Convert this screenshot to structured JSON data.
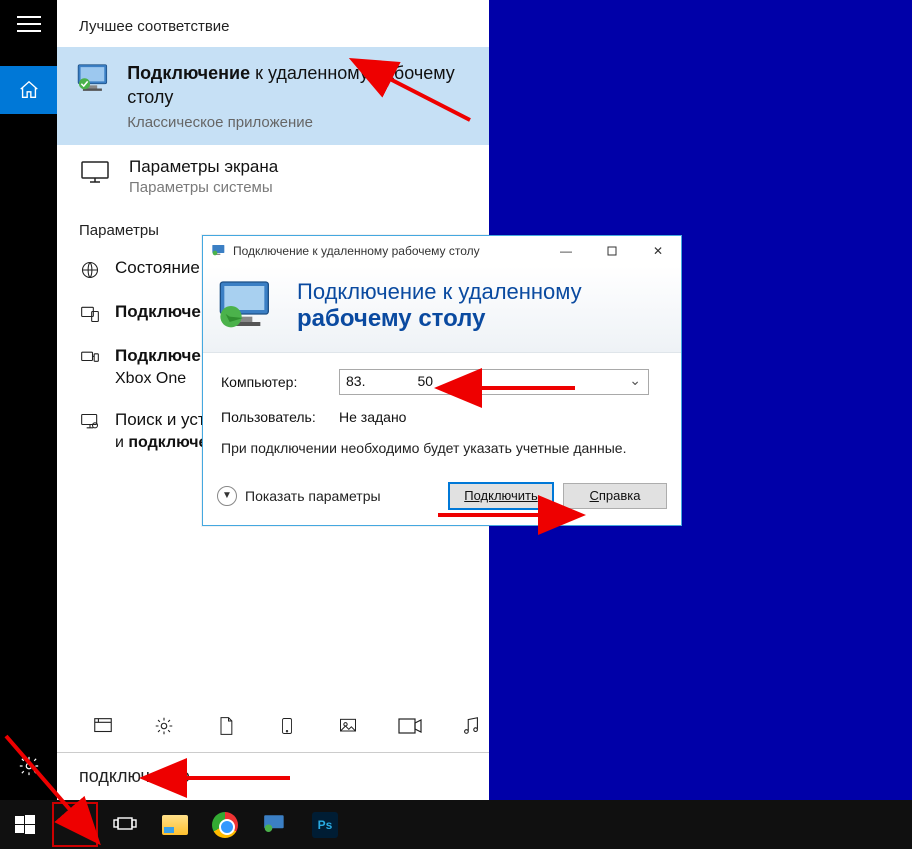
{
  "rail": {
    "home": "home",
    "hamburger": "menu",
    "settings": "settings"
  },
  "panel": {
    "best_match_header": "Лучшее соответствие",
    "best_match": {
      "title_prefix": "Подключение",
      "title_rest": " к удаленному рабочему столу",
      "subtitle": "Классическое приложение"
    },
    "second_result": {
      "title": "Параметры экрана",
      "subtitle": "Параметры системы"
    },
    "params_header": "Параметры",
    "params": [
      {
        "icon": "globe",
        "label": "Состояние сети"
      },
      {
        "icon": "devices",
        "label_prefix": "Подключение",
        "label_rest": ""
      },
      {
        "icon": "stream",
        "label_prefix": "Подключение",
        "label_rest": "",
        "sub": "Xbox One"
      },
      {
        "icon": "monitor-tool",
        "label": "Поиск и устранение",
        "sub_prefix": "и ",
        "sub_bold": "подключение"
      }
    ],
    "categories": [
      "apps",
      "settings",
      "document",
      "phone",
      "image",
      "video",
      "music"
    ],
    "search_value": "подключение"
  },
  "dialog": {
    "titlebar": "Подключение к удаленному рабочему столу",
    "header_line1": "Подключение к удаленному",
    "header_line2": "рабочему столу",
    "computer_label": "Компьютер:",
    "computer_value_pre": "83.",
    "computer_value_post": "50",
    "user_label": "Пользователь:",
    "user_value": "Не задано",
    "note": "При подключении необходимо будет указать учетные данные.",
    "show_params": "Показать параметры",
    "btn_connect": "Подключить",
    "btn_help_u": "С",
    "btn_help_rest": "правка"
  },
  "taskbar": {
    "items": [
      "start",
      "search",
      "taskview",
      "explorer",
      "chrome",
      "rdp",
      "photoshop"
    ]
  }
}
